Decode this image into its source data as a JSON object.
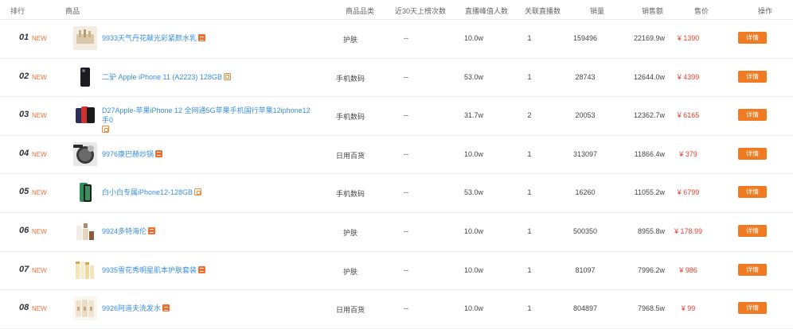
{
  "headers": {
    "rank": "排行",
    "product": "商品",
    "category": "商品品类",
    "live_30d": "近30天上榜次数",
    "peak_viewers": "直播峰值人数",
    "related_live": "关联直播数",
    "sales": "销量",
    "revenue": "销售额",
    "price": "售价",
    "action": "操作"
  },
  "rows": [
    {
      "rank": "01",
      "new": "NEW",
      "name": "9933天气丹花献光彩紧颜水乳",
      "tag": "tmall",
      "category": "护肤",
      "live_30d": "--",
      "peak": "10.0w",
      "related": "1",
      "sales": "159496",
      "revenue": "22169.9w",
      "price": "¥ 1390",
      "button": "详情"
    },
    {
      "rank": "02",
      "new": "NEW",
      "name": "二驴 Apple iPhone 11 (A2223) 128GB",
      "tag": "box",
      "category": "手机数码",
      "live_30d": "--",
      "peak": "53.0w",
      "related": "1",
      "sales": "28743",
      "revenue": "12644.0w",
      "price": "¥ 4399",
      "button": "详情"
    },
    {
      "rank": "03",
      "new": "NEW",
      "name": "D27Apple-苹果iPhone 12 全网通5G苹果手机国行苹果12iphone12手0",
      "tag": "box",
      "category": "手机数码",
      "live_30d": "--",
      "peak": "31.7w",
      "related": "2",
      "sales": "20053",
      "revenue": "12362.7w",
      "price": "¥ 6165",
      "button": "详情"
    },
    {
      "rank": "04",
      "new": "NEW",
      "name": "9976康巴赫炒锅",
      "tag": "tmall",
      "category": "日用百货",
      "live_30d": "--",
      "peak": "10.0w",
      "related": "1",
      "sales": "313097",
      "revenue": "11866.4w",
      "price": "¥ 379",
      "button": "详情"
    },
    {
      "rank": "05",
      "new": "NEW",
      "name": "白小白专属iPhone12-128GB",
      "tag": "box",
      "category": "手机数码",
      "live_30d": "--",
      "peak": "53.0w",
      "related": "1",
      "sales": "16260",
      "revenue": "11055.2w",
      "price": "¥ 6799",
      "button": "详情"
    },
    {
      "rank": "06",
      "new": "NEW",
      "name": "9924多特海伦",
      "tag": "tmall",
      "category": "护肤",
      "live_30d": "--",
      "peak": "10.0w",
      "related": "1",
      "sales": "500350",
      "revenue": "8955.8w",
      "price": "¥ 178.99",
      "button": "详情"
    },
    {
      "rank": "07",
      "new": "NEW",
      "name": "9935雪花秀明星肌本护肤套装",
      "tag": "tmall",
      "category": "护肤",
      "live_30d": "--",
      "peak": "10.0w",
      "related": "1",
      "sales": "81097",
      "revenue": "7996.2w",
      "price": "¥ 986",
      "button": "详情"
    },
    {
      "rank": "08",
      "new": "NEW",
      "name": "9926阿道夫洗发水",
      "tag": "tmall",
      "category": "日用百货",
      "live_30d": "--",
      "peak": "10.0w",
      "related": "1",
      "sales": "804897",
      "revenue": "7968.5w",
      "price": "¥ 99",
      "button": "详情"
    }
  ]
}
